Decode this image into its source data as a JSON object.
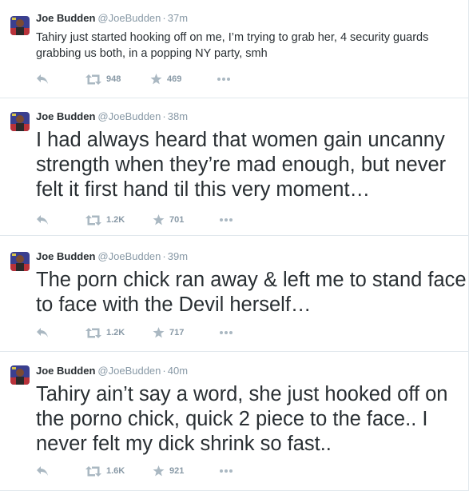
{
  "colors": {
    "border": "#e1e8ed",
    "text": "#292f33",
    "secondary_text": "#8899a6",
    "icon": "#aab8c2"
  },
  "tweets": [
    {
      "author_name": "Joe Budden",
      "author_handle": "@JoeBudden",
      "separator": "·",
      "time": "37m",
      "text": "Tahiry just started hooking off on me, I’m trying to grab her, 4 security guards grabbing us both, in a popping NY party, smh",
      "retweets": "948",
      "favorites": "469",
      "icons": [
        "reply-icon",
        "retweet-icon",
        "favorite-icon",
        "more-icon"
      ]
    },
    {
      "author_name": "Joe Budden",
      "author_handle": "@JoeBudden",
      "separator": "·",
      "time": "38m",
      "text": "I had always heard that women gain uncanny strength when they’re mad enough, but never felt it first hand til this very moment…",
      "retweets": "1.2K",
      "favorites": "701",
      "icons": [
        "reply-icon",
        "retweet-icon",
        "favorite-icon",
        "more-icon"
      ]
    },
    {
      "author_name": "Joe Budden",
      "author_handle": "@JoeBudden",
      "separator": "·",
      "time": "39m",
      "text": "The porn chick ran away & left me to stand face to face with the Devil herself…",
      "retweets": "1.2K",
      "favorites": "717",
      "icons": [
        "reply-icon",
        "retweet-icon",
        "favorite-icon",
        "more-icon"
      ]
    },
    {
      "author_name": "Joe Budden",
      "author_handle": "@JoeBudden",
      "separator": "·",
      "time": "40m",
      "text": "Tahiry ain’t say a word, she just hooked off on the porno chick, quick 2 piece to the face.. I never felt my dick shrink so fast..",
      "retweets": "1.6K",
      "favorites": "921",
      "icons": [
        "reply-icon",
        "retweet-icon",
        "favorite-icon",
        "more-icon"
      ]
    }
  ]
}
